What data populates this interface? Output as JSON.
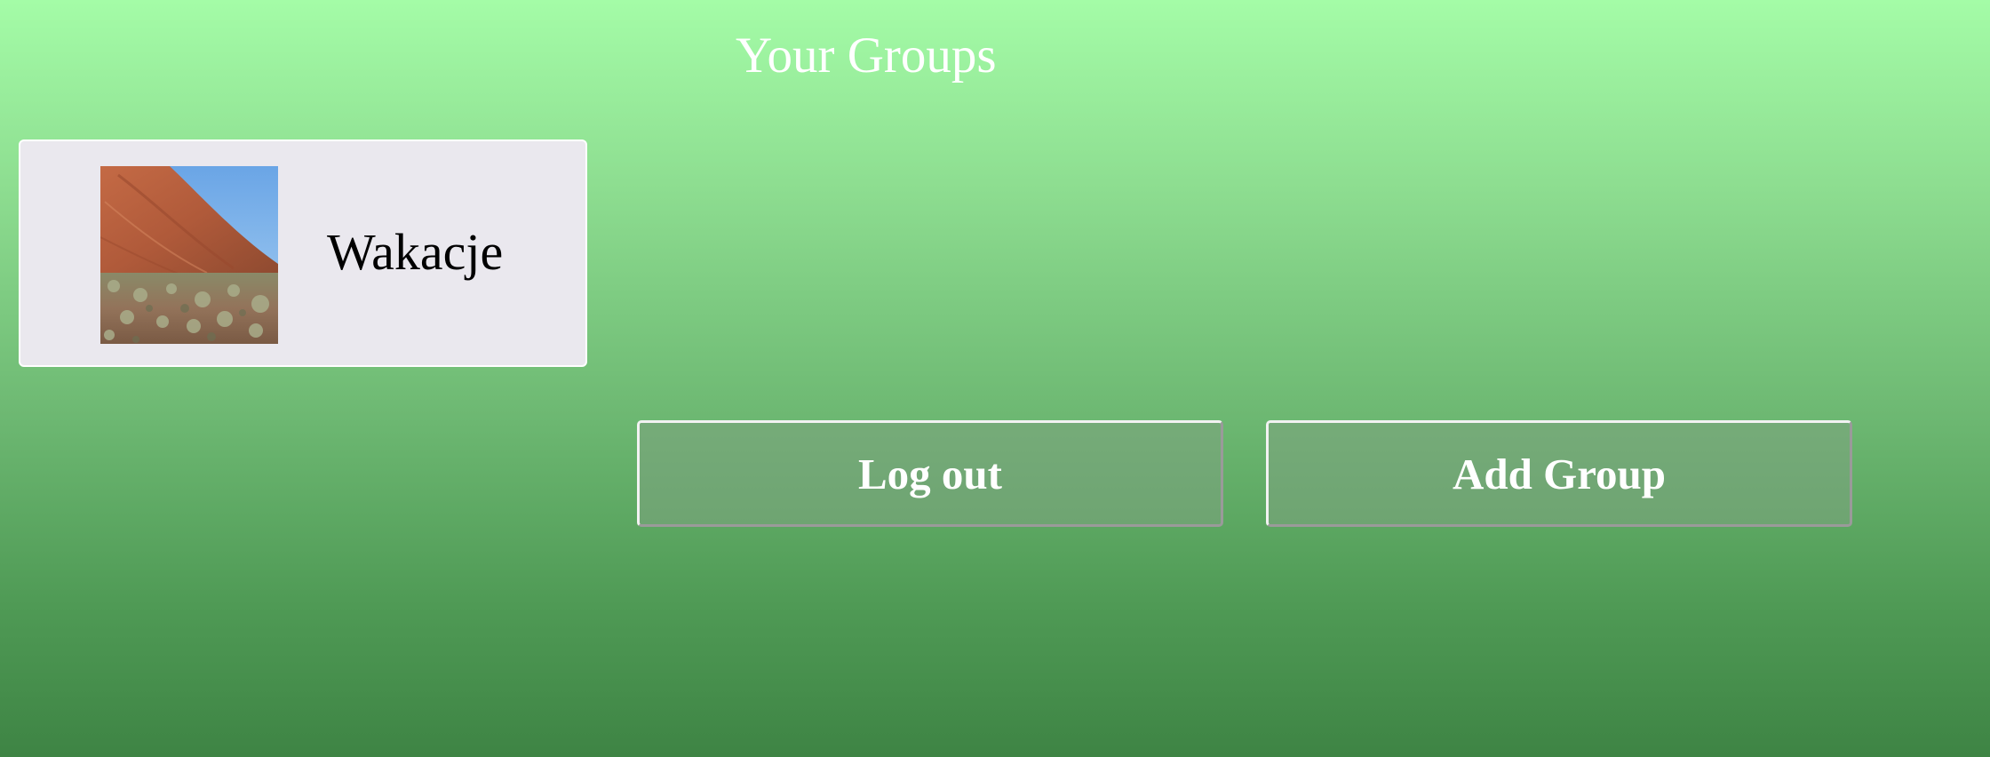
{
  "header": {
    "title": "Your Groups"
  },
  "groups": [
    {
      "name": "Wakacje",
      "image_icon": "desert-rock-photo"
    }
  ],
  "actions": {
    "logout_label": "Log out",
    "add_group_label": "Add Group"
  },
  "colors": {
    "background_top": "#a4fca7",
    "background_bottom": "#3e8444",
    "card_background": "#eae8ee",
    "button_text": "#ffffff"
  }
}
